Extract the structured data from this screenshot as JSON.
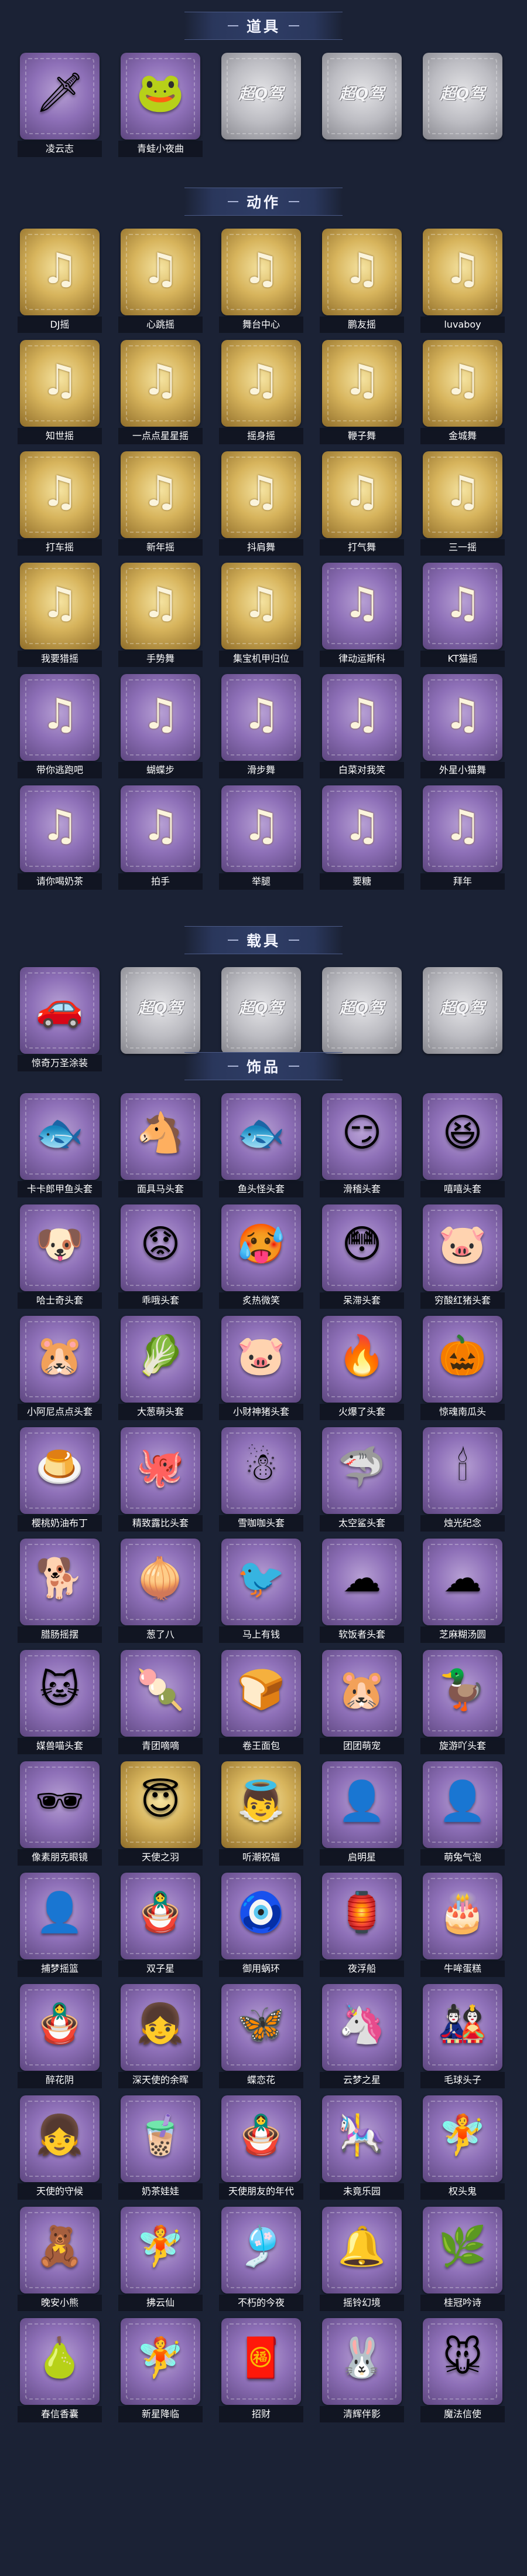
{
  "sections": [
    {
      "title": "道具",
      "items": [
        {
          "label": "凌云志",
          "style": "purple",
          "icon": "🗡"
        },
        {
          "label": "青蛙小夜曲",
          "style": "purple",
          "icon": "🐸"
        },
        {
          "label": "",
          "style": "silver",
          "icon": "超Q驾"
        },
        {
          "label": "",
          "style": "silver",
          "icon": "超Q驾"
        },
        {
          "label": "",
          "style": "silver",
          "icon": "超Q驾"
        }
      ]
    },
    {
      "title": "动作",
      "items": [
        {
          "label": "DJ摇",
          "style": "gold",
          "icon": "♫"
        },
        {
          "label": "心跳摇",
          "style": "gold",
          "icon": "♫"
        },
        {
          "label": "舞台中心",
          "style": "gold",
          "icon": "♫"
        },
        {
          "label": "鹏友摇",
          "style": "gold",
          "icon": "♫"
        },
        {
          "label": "luvaboy",
          "style": "gold",
          "icon": "♫"
        },
        {
          "label": "知世摇",
          "style": "gold",
          "icon": "♫"
        },
        {
          "label": "一点点星星摇",
          "style": "gold",
          "icon": "♫"
        },
        {
          "label": "摇身摇",
          "style": "gold",
          "icon": "♫"
        },
        {
          "label": "鞭子舞",
          "style": "gold",
          "icon": "♫"
        },
        {
          "label": "金城舞",
          "style": "gold",
          "icon": "♫"
        },
        {
          "label": "打车摇",
          "style": "gold",
          "icon": "♫"
        },
        {
          "label": "新年摇",
          "style": "gold",
          "icon": "♫"
        },
        {
          "label": "抖肩舞",
          "style": "gold",
          "icon": "♫"
        },
        {
          "label": "打气舞",
          "style": "gold",
          "icon": "♫"
        },
        {
          "label": "三一摇",
          "style": "gold",
          "icon": "♫"
        },
        {
          "label": "我要猎摇",
          "style": "gold",
          "icon": "♫"
        },
        {
          "label": "手势舞",
          "style": "gold",
          "icon": "♫"
        },
        {
          "label": "集宝机甲归位",
          "style": "gold",
          "icon": "♫"
        },
        {
          "label": "律动运斯科",
          "style": "purple",
          "icon": "♫"
        },
        {
          "label": "KT猫摇",
          "style": "purple",
          "icon": "♫"
        },
        {
          "label": "带你逃跑吧",
          "style": "purple",
          "icon": "♫"
        },
        {
          "label": "蝴蝶步",
          "style": "purple",
          "icon": "♫"
        },
        {
          "label": "滑步舞",
          "style": "purple",
          "icon": "♫"
        },
        {
          "label": "白菜对我笑",
          "style": "purple",
          "icon": "♫"
        },
        {
          "label": "外星小猫舞",
          "style": "purple",
          "icon": "♫"
        },
        {
          "label": "请你喝奶茶",
          "style": "purple",
          "icon": "♫"
        },
        {
          "label": "拍手",
          "style": "purple",
          "icon": "♫"
        },
        {
          "label": "举腿",
          "style": "purple",
          "icon": "♫"
        },
        {
          "label": "要糖",
          "style": "purple",
          "icon": "♫"
        },
        {
          "label": "拜年",
          "style": "purple",
          "icon": "♫"
        }
      ]
    },
    {
      "title": "载具",
      "items": [
        {
          "label": "惊奇万圣涂装",
          "style": "purple",
          "icon": "🚗"
        },
        {
          "label": "",
          "style": "silver",
          "icon": "超Q驾"
        },
        {
          "label": "",
          "style": "silver",
          "icon": "超Q驾"
        },
        {
          "label": "",
          "style": "silver",
          "icon": "超Q驾"
        },
        {
          "label": "",
          "style": "silver",
          "icon": "超Q驾"
        }
      ]
    },
    {
      "title": "饰品",
      "items": [
        {
          "label": "卡卡郎甲鱼头套",
          "style": "purple",
          "icon": "🐟"
        },
        {
          "label": "面具马头套",
          "style": "purple",
          "icon": "🐴"
        },
        {
          "label": "鱼头怪头套",
          "style": "purple",
          "icon": "🐟"
        },
        {
          "label": "滑稽头套",
          "style": "purple",
          "icon": "😏"
        },
        {
          "label": "嘻嘻头套",
          "style": "purple",
          "icon": "😆"
        },
        {
          "label": "哈士奇头套",
          "style": "purple",
          "icon": "🐶"
        },
        {
          "label": "乖哦头套",
          "style": "purple",
          "icon": "😟"
        },
        {
          "label": "炙热微笑",
          "style": "purple",
          "icon": "🥵"
        },
        {
          "label": "呆滞头套",
          "style": "purple",
          "icon": "😳"
        },
        {
          "label": "穷酸红猪头套",
          "style": "purple",
          "icon": "🐷"
        },
        {
          "label": "小阿尼点点头套",
          "style": "purple",
          "icon": "🐹"
        },
        {
          "label": "大葱萌头套",
          "style": "purple",
          "icon": "🥬"
        },
        {
          "label": "小财神猪头套",
          "style": "purple",
          "icon": "🐷"
        },
        {
          "label": "火爆了头套",
          "style": "purple",
          "icon": "🔥"
        },
        {
          "label": "惊魂南瓜头",
          "style": "purple",
          "icon": "🎃"
        },
        {
          "label": "樱桃奶油布丁",
          "style": "purple",
          "icon": "🍮"
        },
        {
          "label": "精致露比头套",
          "style": "purple",
          "icon": "🐙"
        },
        {
          "label": "雪咖咖头套",
          "style": "purple",
          "icon": "☃"
        },
        {
          "label": "太空鲨头套",
          "style": "purple",
          "icon": "🦈"
        },
        {
          "label": "烛光纪念",
          "style": "purple",
          "icon": "🕯"
        },
        {
          "label": "腊肠摇摆",
          "style": "purple",
          "icon": "🐕"
        },
        {
          "label": "葱了八",
          "style": "purple",
          "icon": "🧅"
        },
        {
          "label": "马上有钱",
          "style": "purple",
          "icon": "🐦"
        },
        {
          "label": "软饭者头套",
          "style": "purple",
          "icon": "☁"
        },
        {
          "label": "芝麻糊汤圆",
          "style": "purple",
          "icon": "☁"
        },
        {
          "label": "媒兽喵头套",
          "style": "purple",
          "icon": "🐱"
        },
        {
          "label": "青团嘀嘀",
          "style": "purple",
          "icon": "🍡"
        },
        {
          "label": "卷王面包",
          "style": "purple",
          "icon": "🍞"
        },
        {
          "label": "团团萌宠",
          "style": "purple",
          "icon": "🐹"
        },
        {
          "label": "旋游吖头套",
          "style": "purple",
          "icon": "🦆"
        },
        {
          "label": "像素朋克眼镜",
          "style": "purple",
          "icon": "🕶"
        },
        {
          "label": "天使之羽",
          "style": "gold",
          "icon": "😇"
        },
        {
          "label": "听潮祝福",
          "style": "gold",
          "icon": "👼"
        },
        {
          "label": "启明星",
          "style": "purple",
          "icon": "👤"
        },
        {
          "label": "萌兔气泡",
          "style": "purple",
          "icon": "👤"
        },
        {
          "label": "捕梦摇篮",
          "style": "purple",
          "icon": "👤"
        },
        {
          "label": "双子星",
          "style": "purple",
          "icon": "🪆"
        },
        {
          "label": "御用蜗环",
          "style": "purple",
          "icon": "🧿"
        },
        {
          "label": "夜浮船",
          "style": "purple",
          "icon": "🏮"
        },
        {
          "label": "牛哞蛋糕",
          "style": "purple",
          "icon": "🎂"
        },
        {
          "label": "醉花阴",
          "style": "purple",
          "icon": "🪆"
        },
        {
          "label": "深天使的余晖",
          "style": "purple",
          "icon": "👧"
        },
        {
          "label": "蝶恋花",
          "style": "purple",
          "icon": "🦋"
        },
        {
          "label": "云梦之星",
          "style": "purple",
          "icon": "🦄"
        },
        {
          "label": "毛球头子",
          "style": "purple",
          "icon": "🎎"
        },
        {
          "label": "天使的守候",
          "style": "purple",
          "icon": "👧"
        },
        {
          "label": "奶茶娃娃",
          "style": "purple",
          "icon": "🧋"
        },
        {
          "label": "天使朋友的年代",
          "style": "purple",
          "icon": "🪆"
        },
        {
          "label": "未竟乐园",
          "style": "purple",
          "icon": "🎠"
        },
        {
          "label": "权头鬼",
          "style": "purple",
          "icon": "🧚"
        },
        {
          "label": "晚安小熊",
          "style": "purple",
          "icon": "🧸"
        },
        {
          "label": "拂云仙",
          "style": "purple",
          "icon": "🧚"
        },
        {
          "label": "不朽的今夜",
          "style": "purple",
          "icon": "🎐"
        },
        {
          "label": "摇铃幻境",
          "style": "purple",
          "icon": "🔔"
        },
        {
          "label": "桂冠吟诗",
          "style": "purple",
          "icon": "🌿"
        },
        {
          "label": "春信香囊",
          "style": "purple",
          "icon": "🍐"
        },
        {
          "label": "新星降临",
          "style": "purple",
          "icon": "🧚"
        },
        {
          "label": "招财",
          "style": "purple",
          "icon": "🧧"
        },
        {
          "label": "清辉伴影",
          "style": "purple",
          "icon": "🐰"
        },
        {
          "label": "魔法信使",
          "style": "purple",
          "icon": "🐭"
        }
      ]
    }
  ]
}
